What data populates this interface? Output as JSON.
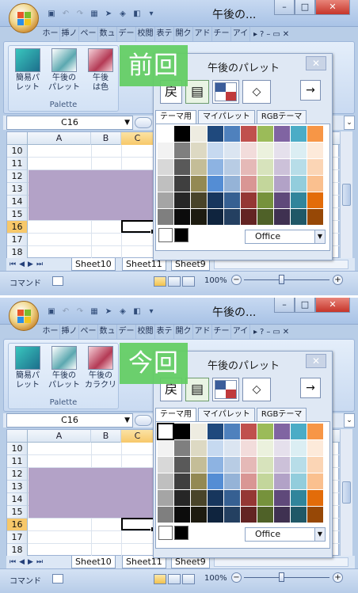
{
  "screens": [
    {
      "badge": "前回",
      "title": "午後の...",
      "ribbon_tabs": [
        "ホー",
        "挿ノ",
        "ペー",
        "数ュ",
        "デー",
        "校閲",
        "表テ",
        "開ク",
        "アド",
        "チー",
        "アイ"
      ],
      "group": {
        "buttons": [
          {
            "label": "簡易パ\nレット"
          },
          {
            "label": "午後の\nパレット"
          },
          {
            "label": "午後\nは色"
          }
        ],
        "label": "Palette"
      },
      "name_box": "C16",
      "columns": [
        "A",
        "B",
        "C"
      ],
      "rows": [
        "10",
        "11",
        "12",
        "13",
        "14",
        "15",
        "16",
        "17",
        "18"
      ],
      "sheet_tabs": [
        "Sheet10",
        "Sheet11",
        "Sheet9"
      ],
      "status": "コマンド",
      "zoom": "100%",
      "palette": {
        "title": "午後のパレット",
        "undo": "戻",
        "tabs": [
          "テーマ用",
          "マイパレット",
          "RGBテーマ"
        ],
        "active_tab": 0,
        "theme": "Office",
        "next": "→"
      }
    },
    {
      "badge": "今回",
      "title": "午後の...",
      "ribbon_tabs": [
        "ホー",
        "挿ノ",
        "ペー",
        "数ュ",
        "デー",
        "校閲",
        "表テ",
        "開ク",
        "アド",
        "チー",
        "アイ"
      ],
      "group": {
        "buttons": [
          {
            "label": "簡易パ\nレット"
          },
          {
            "label": "午後の\nパレット"
          },
          {
            "label": "午後の\nカラクリ"
          }
        ],
        "label": "Palette"
      },
      "name_box": "C16",
      "columns": [
        "A",
        "B",
        "C"
      ],
      "rows": [
        "10",
        "11",
        "12",
        "13",
        "14",
        "15",
        "16",
        "17",
        "18"
      ],
      "sheet_tabs": [
        "Sheet10",
        "Sheet11",
        "Sheet9"
      ],
      "status": "コマンド",
      "zoom": "100%",
      "palette": {
        "title": "午後のパレット",
        "undo": "戻",
        "tabs": [
          "テーマ用",
          "マイパレット",
          "RGBテーマ"
        ],
        "active_tab": 0,
        "theme": "Office",
        "next": "→"
      }
    }
  ],
  "colors": {
    "purple_fill": "#b3a2c7",
    "badge_green": "#63ce63",
    "accent_row_header": "#f7c86a"
  },
  "palette_colors": [
    [
      "#ffffff",
      "#000000",
      "#eeece1",
      "#1f497d",
      "#4f81bd",
      "#c0504d",
      "#9bbb59",
      "#8064a2",
      "#4bacc6",
      "#f79646"
    ],
    [
      "#f2f2f2",
      "#7f7f7f",
      "#ddd9c3",
      "#c6d9f0",
      "#dbe5f1",
      "#f2dcdb",
      "#ebf1dd",
      "#e5e0ec",
      "#dbeef3",
      "#fdeada"
    ],
    [
      "#d8d8d8",
      "#595959",
      "#c4bd97",
      "#8db3e2",
      "#b8cce4",
      "#e5b9b7",
      "#d7e3bc",
      "#ccc1d9",
      "#b7dde8",
      "#fbd5b5"
    ],
    [
      "#bfbfbf",
      "#3f3f3f",
      "#938953",
      "#548dd4",
      "#95b3d7",
      "#d99694",
      "#c3d69b",
      "#b2a2c7",
      "#92cddc",
      "#fac08f"
    ],
    [
      "#a5a5a5",
      "#262626",
      "#494429",
      "#17365d",
      "#366092",
      "#953734",
      "#76923c",
      "#5f497a",
      "#31859b",
      "#e36c09"
    ],
    [
      "#7f7f7f",
      "#0c0c0c",
      "#1d1b10",
      "#0f243e",
      "#244061",
      "#632423",
      "#4f6128",
      "#3f3151",
      "#205867",
      "#974806"
    ]
  ]
}
